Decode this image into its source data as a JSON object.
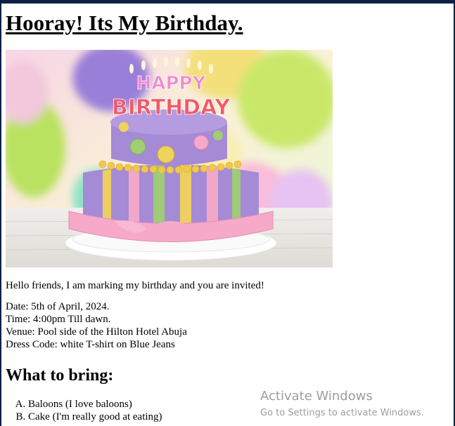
{
  "page": {
    "heading": "Hooray! Its My Birthday.",
    "intro": "Hello friends, I am marking my birthday and you are invited!",
    "details": {
      "date": "Date: 5th of April, 2024.",
      "time": "Time: 4:00pm Till dawn.",
      "venue": "Venue: Pool side of the Hilton Hotel Abuja",
      "dress_code": "Dress Code: white T-shirt on Blue Jeans"
    },
    "bring_heading": "What to bring:",
    "bring_items": [
      "Baloons (I love baloons)",
      "Cake (I'm really good at eating)"
    ]
  },
  "cake_image": {
    "candle_text_top": "HAPPY",
    "candle_text_bottom": "BIRTHDAY",
    "colors": {
      "purple": "#a58ad6",
      "yellow": "#f0d35a",
      "green": "#9fce73",
      "pink": "#f6a9c8"
    }
  },
  "watermark": {
    "title": "Activate Windows",
    "subtitle": "Go to Settings to activate Windows."
  }
}
